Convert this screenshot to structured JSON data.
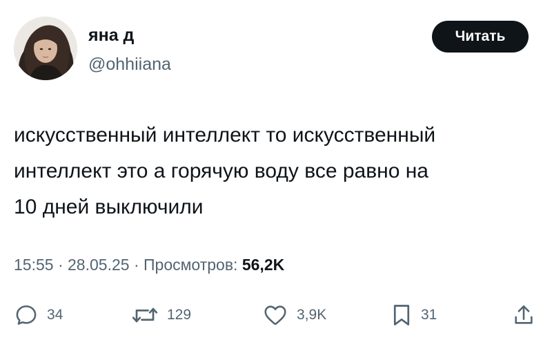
{
  "user": {
    "display_name": "яна д",
    "handle": "@ohhiiana"
  },
  "follow_button": {
    "label": "Читать"
  },
  "tweet": {
    "text_lines": [
      "искусственный интеллект то искусственный",
      "интеллект это а горячую воду все равно на",
      "10 дней выключили"
    ]
  },
  "meta": {
    "time": "15:55",
    "separator": "·",
    "date": "28.05.25",
    "views_label": "Просмотров:",
    "views_count": "56,2K"
  },
  "actions": {
    "replies": {
      "icon": "reply-icon",
      "count": "34"
    },
    "retweets": {
      "icon": "retweet-icon",
      "count": "129"
    },
    "likes": {
      "icon": "heart-icon",
      "count": "3,9K"
    },
    "bookmarks": {
      "icon": "bookmark-icon",
      "count": "31"
    },
    "share": {
      "icon": "share-icon"
    }
  },
  "colors": {
    "text": "#0f1419",
    "secondary": "#536471",
    "button_bg": "#0f1419",
    "button_text": "#ffffff"
  }
}
